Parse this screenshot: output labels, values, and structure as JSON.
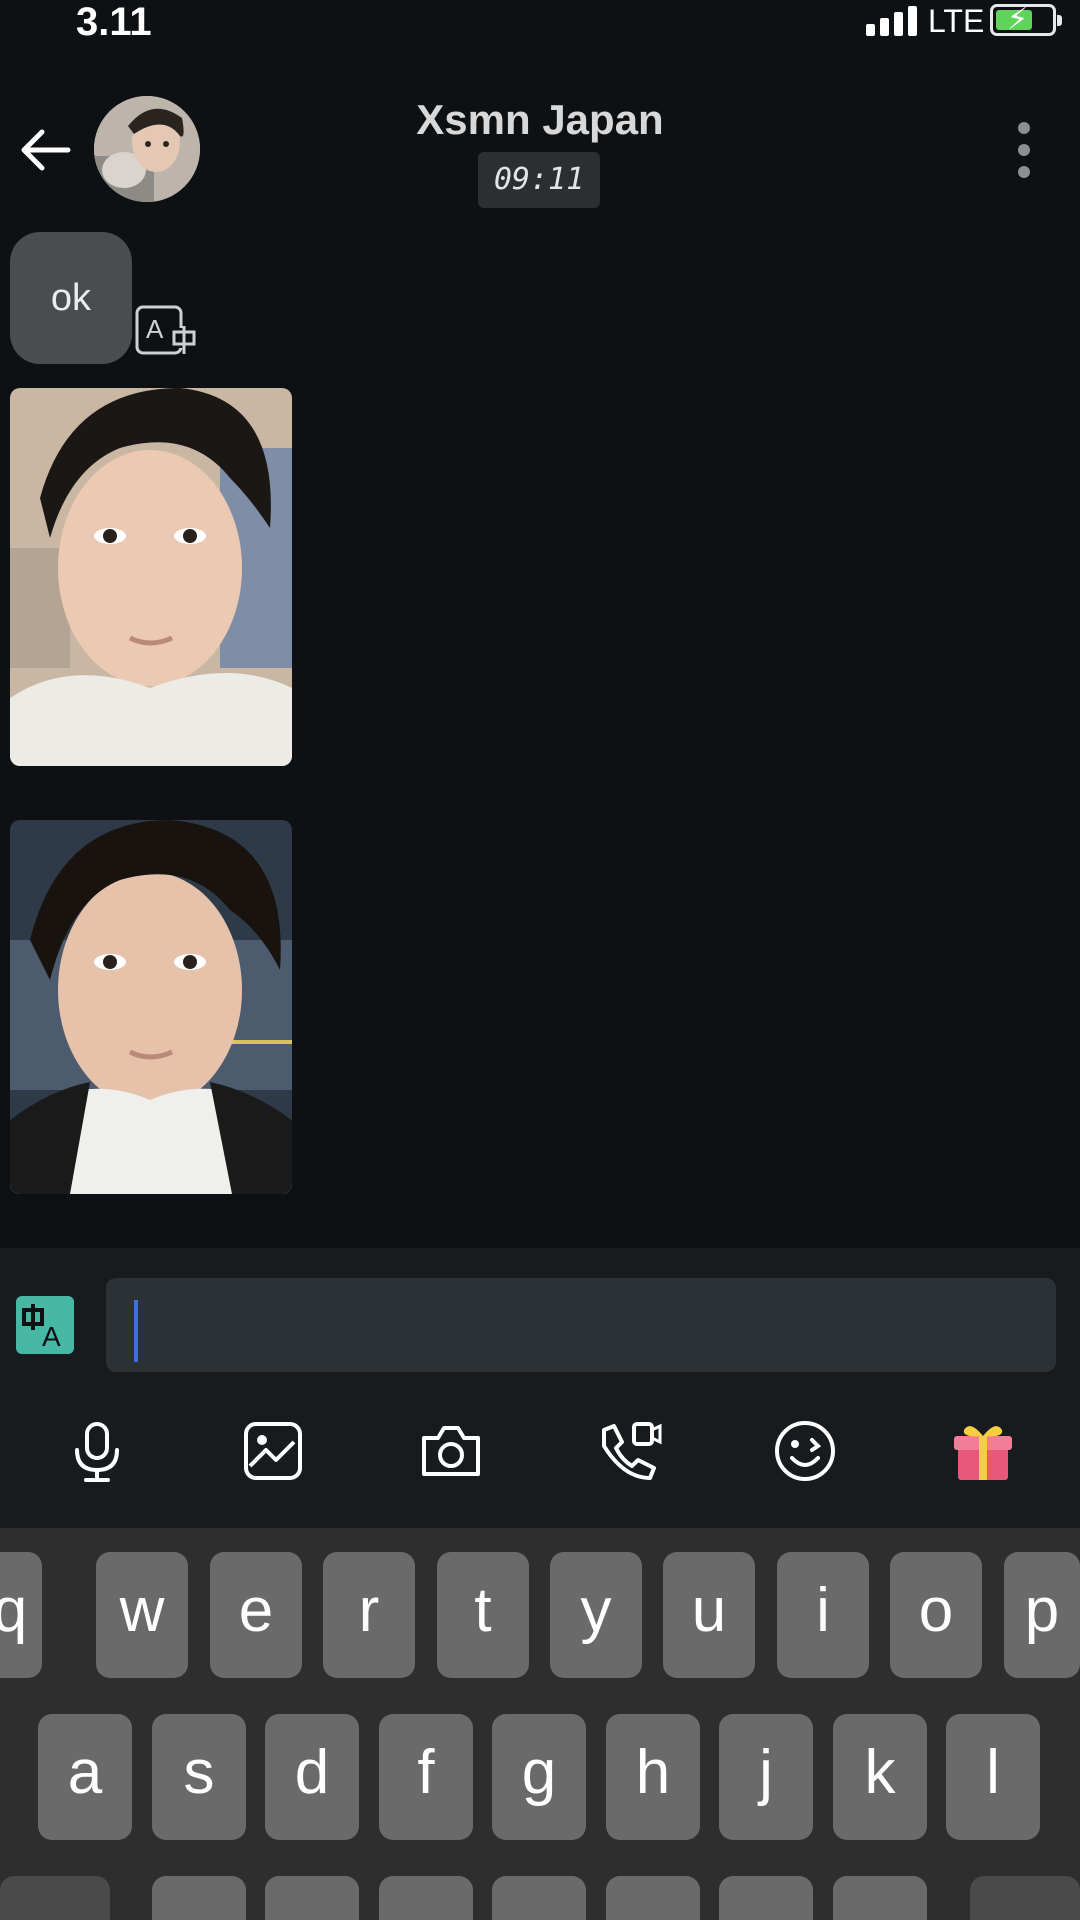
{
  "status_bar": {
    "time": "3.11",
    "network": "LTE"
  },
  "header": {
    "contact_name": "Xsmn Japan",
    "timestamp": "09:11"
  },
  "messages": [
    {
      "type": "text",
      "text": "ok"
    },
    {
      "type": "photo"
    },
    {
      "type": "photo"
    }
  ],
  "composer": {
    "input_value": "",
    "tools": [
      "microphone-icon",
      "image-icon",
      "camera-icon",
      "video-call-icon",
      "emoji-icon",
      "gift-icon"
    ]
  },
  "keyboard": {
    "row1": [
      "q",
      "w",
      "e",
      "r",
      "t",
      "y",
      "u",
      "i",
      "o",
      "p"
    ],
    "row2": [
      "a",
      "s",
      "d",
      "f",
      "g",
      "h",
      "j",
      "k",
      "l"
    ]
  },
  "colors": {
    "background": "#0d1114",
    "bubble": "#4a4d50",
    "accent_teal": "#47b8a4",
    "cursor_blue": "#3e6fe0",
    "battery_green": "#5fd35a"
  }
}
